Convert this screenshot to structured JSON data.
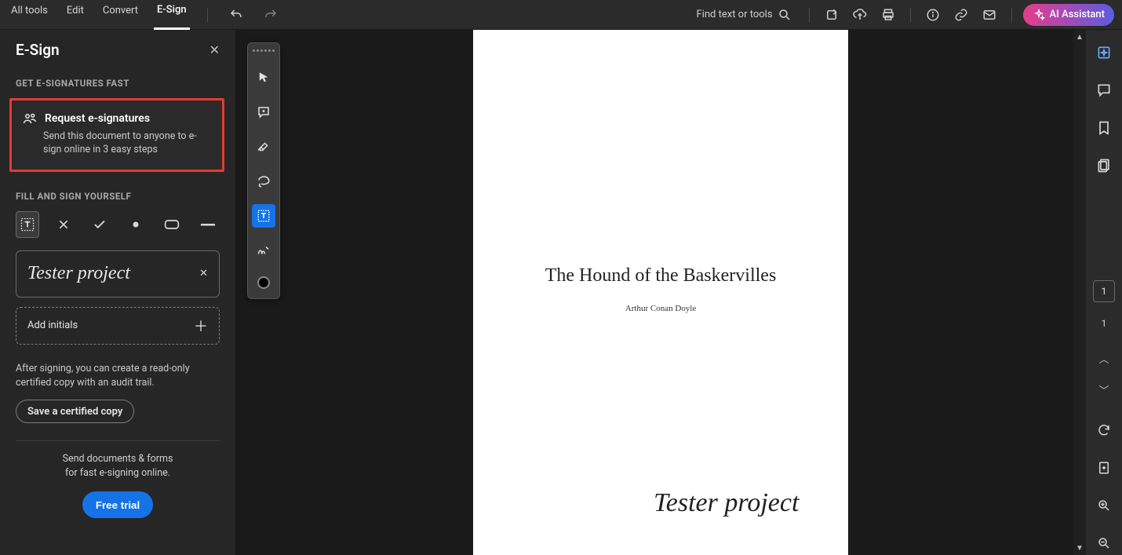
{
  "topbar": {
    "tabs": {
      "all_tools": "All tools",
      "edit": "Edit",
      "convert": "Convert",
      "esign": "E-Sign"
    },
    "search_label": "Find text or tools",
    "ai_label": "AI Assistant"
  },
  "panel": {
    "title": "E-Sign",
    "section_get": "GET E-SIGNATURES FAST",
    "request_title": "Request e-signatures",
    "request_desc": "Send this document to anyone to e-sign online in 3 easy steps",
    "section_fill": "FILL AND SIGN YOURSELF",
    "signature": "Tester project",
    "add_initials": "Add initials",
    "after_text": "After signing, you can create a read-only certified copy with an audit trail.",
    "save_cert": "Save a certified copy",
    "send_text_l1": "Send documents & forms",
    "send_text_l2": "for fast e-signing online.",
    "free_trial": "Free trial"
  },
  "doc": {
    "title": "The Hound of the Baskervilles",
    "author": "Arthur Conan Doyle",
    "signature": "Tester project"
  },
  "pager": {
    "current": "1",
    "total": "1"
  },
  "icons": {
    "undo": "undo-icon",
    "redo": "redo-icon",
    "search": "search-icon",
    "export": "export-icon",
    "cloud": "cloud-icon",
    "print": "print-icon",
    "info": "info-icon",
    "linkchain": "link-icon",
    "mail": "mail-icon",
    "aispark": "ai-spark-icon",
    "pointer": "pointer-icon",
    "comment": "comment-icon",
    "draw": "draw-icon",
    "lasso": "lasso-icon",
    "textbox": "textbox-icon",
    "signature": "signature-icon",
    "color": "color-swatch",
    "text": "text-tool",
    "xmark": "x-mark",
    "check": "check-mark",
    "dot": "dot-mark",
    "roundrect": "roundrect-mark",
    "dash": "dash-mark",
    "rail_gen": "generative-icon",
    "rail_comment": "comments-icon",
    "rail_bookmark": "bookmark-icon",
    "rail_pages": "pages-icon",
    "rail_refresh": "refresh-icon",
    "rail_fit": "fit-icon",
    "rail_zin": "zoom-in-icon",
    "rail_zout": "zoom-out-icon",
    "chev_up": "chevron-up-icon",
    "chev_down": "chevron-down-icon",
    "plus": "plus-icon",
    "close": "close-icon"
  }
}
